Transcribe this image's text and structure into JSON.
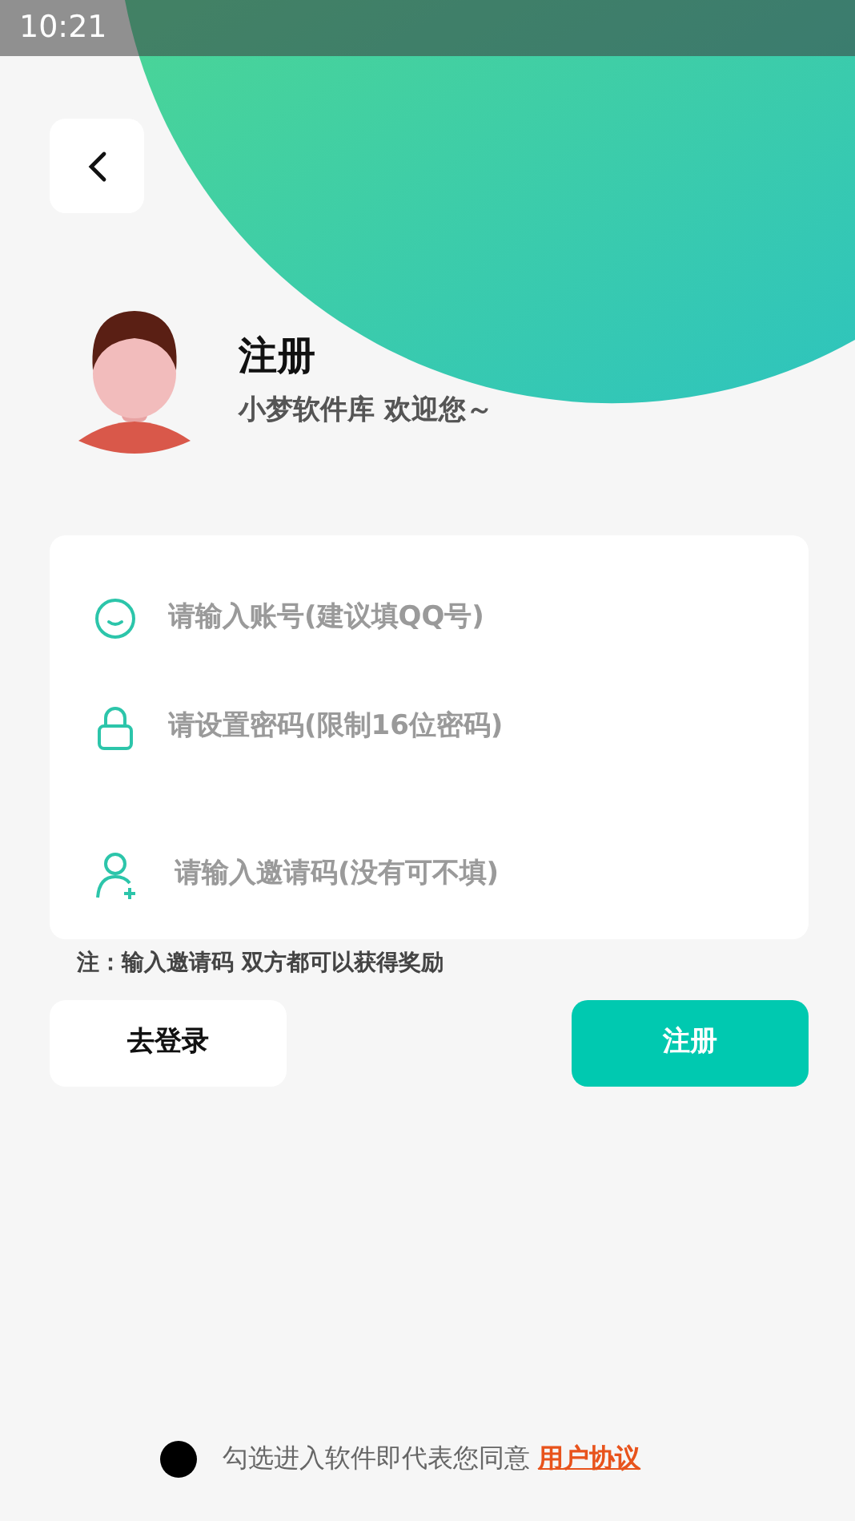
{
  "status_bar": {
    "time": "10:21"
  },
  "header": {
    "title": "注册",
    "subtitle": "小梦软件库 欢迎您～"
  },
  "fields": [
    {
      "kind": "account",
      "placeholder": "请输入账号(建议填QQ号)"
    },
    {
      "kind": "password",
      "placeholder": "请设置密码(限制16位密码)"
    },
    {
      "kind": "invite",
      "placeholder": "请输入邀请码(没有可不填)"
    }
  ],
  "note": "注：输入邀请码 双方都可以获得奖励",
  "buttons": [
    {
      "kind": "secondary",
      "label": "去登录"
    },
    {
      "kind": "primary",
      "label": "注册"
    }
  ],
  "agreement": {
    "checked": false,
    "text": "勾选进入软件即代表您同意",
    "link": "用户协议"
  }
}
